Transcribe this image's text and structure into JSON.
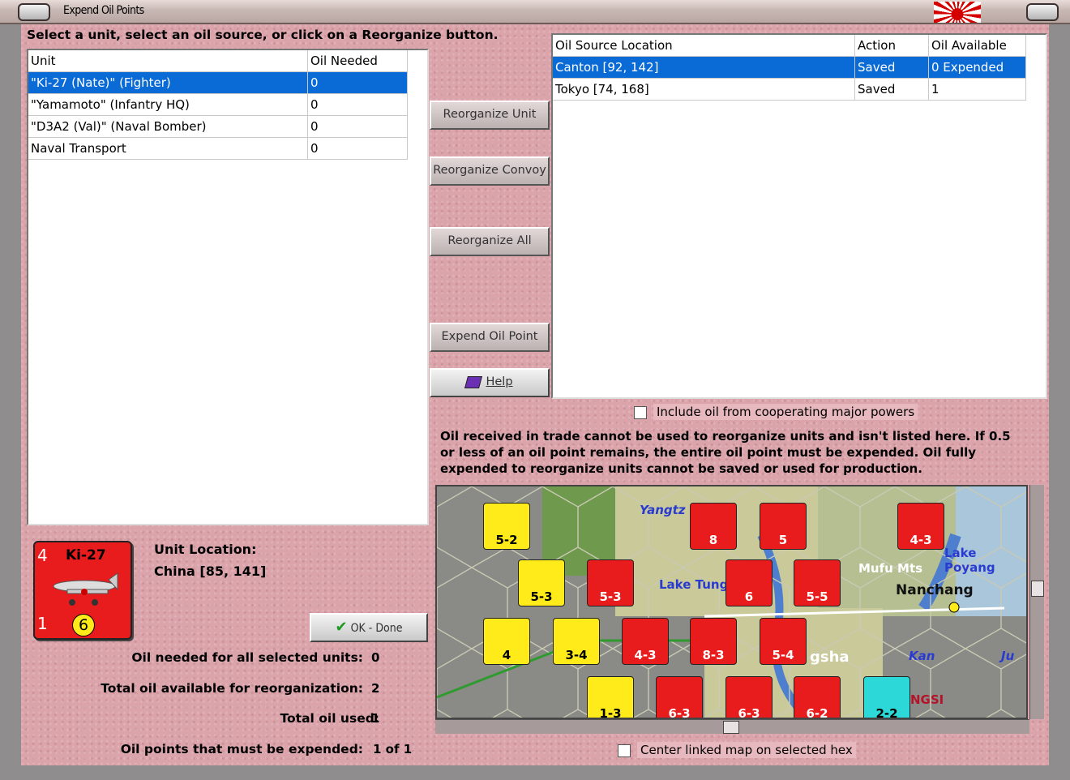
{
  "window": {
    "title": "Expend Oil Points"
  },
  "instruction": "Select a unit, select an oil source, or click on a Reorganize button.",
  "units_table": {
    "headers": [
      "Unit",
      "Oil Needed"
    ],
    "rows": [
      {
        "unit": "\"Ki-27 (Nate)\" (Fighter)",
        "oil": "0"
      },
      {
        "unit": "\"Yamamoto\" (Infantry HQ)",
        "oil": "0"
      },
      {
        "unit": "\"D3A2 (Val)\" (Naval Bomber)",
        "oil": "0"
      },
      {
        "unit": "Naval Transport",
        "oil": "0"
      }
    ]
  },
  "oil_table": {
    "headers": [
      "Oil Source Location",
      "Action",
      "Oil Available"
    ],
    "rows": [
      {
        "location": "Canton [92, 142]",
        "action": "Saved",
        "available": "0 Expended"
      },
      {
        "location": "Tokyo [74, 168]",
        "action": "Saved",
        "available": "1"
      }
    ]
  },
  "buttons": {
    "reorg_unit": "Reorganize Unit",
    "reorg_convoy": "Reorganize Convoy",
    "reorg_all": "Reorganize All",
    "expend": "Expend Oil Point",
    "help": "Help",
    "ok": "OK - Done"
  },
  "include_oil": "Include oil from cooperating major powers",
  "note": "Oil received in trade cannot be used to reorganize units and isn't listed here.  If 0.5 or less of an oil point remains, the entire oil point must be expended.   Oil fully expended to reorganize units cannot be saved or used for production.",
  "center_map": "Center linked map on selected hex",
  "unit_card": {
    "name": "Ki-27",
    "top_left": "4",
    "bottom_left": "1",
    "circle": "6"
  },
  "unit_location": {
    "label": "Unit Location:",
    "value": "China [85, 141]"
  },
  "summary": [
    {
      "label": "Oil needed for all selected units:",
      "value": "0"
    },
    {
      "label": "Total oil available for reorganization:",
      "value": "2"
    },
    {
      "label": "Total oil used:",
      "value": "1"
    },
    {
      "label": "Oil points that must be expended:",
      "value": "1 of 1"
    }
  ],
  "map": {
    "labels": [
      "Yangtz",
      "Lake Tung",
      "Mufu Mts",
      "Nanchang",
      "Lake Poyang",
      "Kan",
      "Ju",
      "gsha",
      "NGSI"
    ],
    "counters": [
      {
        "value": "5-2",
        "color": "yellow"
      },
      {
        "value": "8",
        "color": "red"
      },
      {
        "value": "5",
        "color": "red"
      },
      {
        "value": "4-3",
        "color": "red"
      },
      {
        "value": "5-3",
        "color": "yellow"
      },
      {
        "value": "5-3",
        "color": "red"
      },
      {
        "value": "6",
        "color": "red"
      },
      {
        "value": "5-5",
        "color": "red"
      },
      {
        "value": "4",
        "color": "yellow"
      },
      {
        "value": "3-4",
        "color": "yellow"
      },
      {
        "value": "4-3",
        "color": "red"
      },
      {
        "value": "8-3",
        "color": "red"
      },
      {
        "value": "5-4",
        "color": "red"
      },
      {
        "value": "1-3",
        "color": "yellow"
      },
      {
        "value": "6-3",
        "color": "red"
      },
      {
        "value": "6-3",
        "color": "red"
      },
      {
        "value": "6-2",
        "color": "red"
      },
      {
        "value": "2-2",
        "color": "cyan"
      }
    ]
  },
  "colors": {
    "selection": "#0a6ad6",
    "background": "#dba4ab",
    "counter_red": "#e81c1c",
    "counter_yellow": "#ffeb1a"
  }
}
